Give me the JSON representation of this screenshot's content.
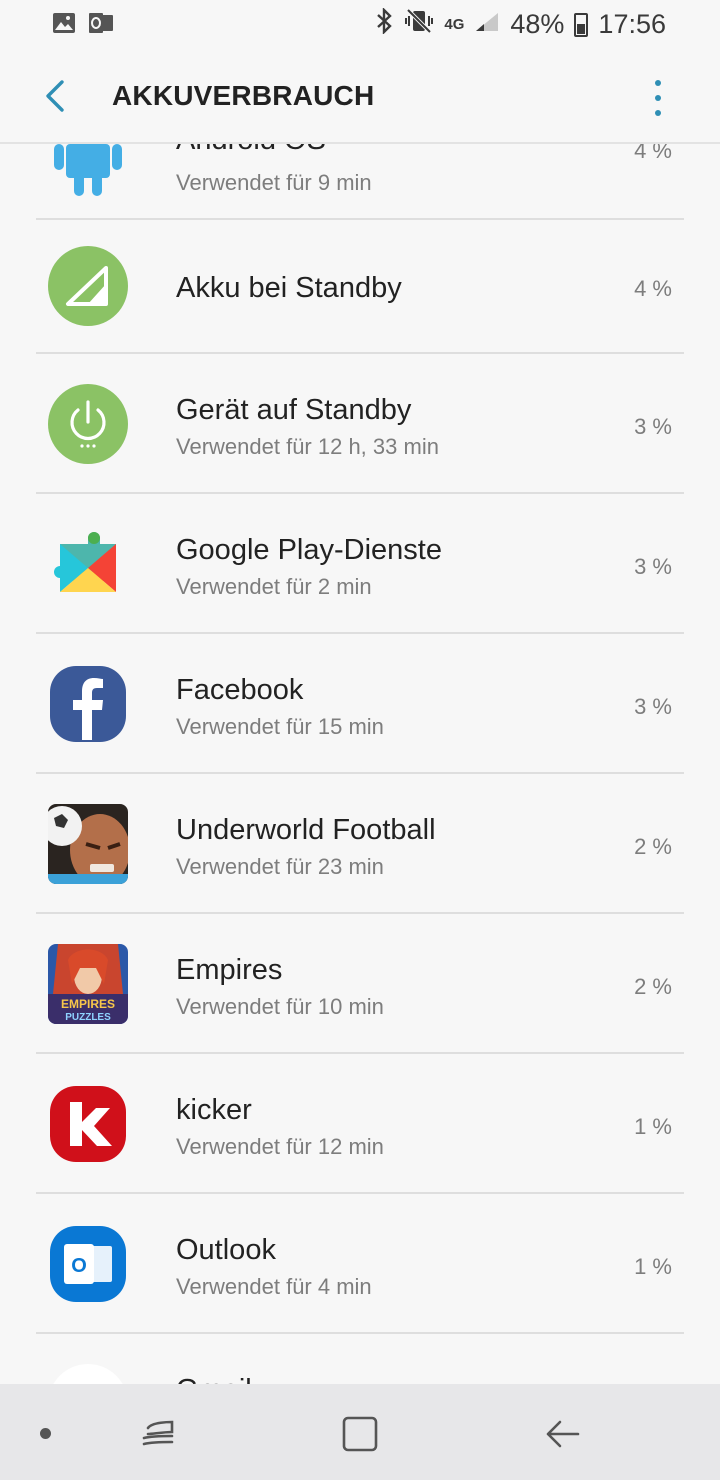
{
  "status_bar": {
    "left_icons": [
      "gallery-icon",
      "outlook-notification-icon"
    ],
    "right_icons": [
      "bluetooth-icon",
      "vibrate-mute-icon",
      "network-4g-icon",
      "signal-icon"
    ],
    "network": "4G",
    "battery_percent": "48%",
    "time": "17:56"
  },
  "app_bar": {
    "title": "AKKUVERBRAUCH",
    "back_icon": "back-arrow-icon",
    "menu_icon": "more-vertical-icon",
    "accent_color": "#2f8fb5"
  },
  "items": [
    {
      "name": "Android OS",
      "usage": "Verwendet für 9 min",
      "percent": "4 %",
      "icon": "android-icon"
    },
    {
      "name": "Akku bei Standby",
      "usage": "",
      "percent": "4 %",
      "icon": "cell-standby-icon"
    },
    {
      "name": "Gerät auf Standby",
      "usage": "Verwendet für 12 h, 33 min",
      "percent": "3 %",
      "icon": "device-standby-icon"
    },
    {
      "name": "Google Play-Dienste",
      "usage": "Verwendet für 2 min",
      "percent": "3 %",
      "icon": "google-play-services-icon"
    },
    {
      "name": "Facebook",
      "usage": "Verwendet für 15 min",
      "percent": "3 %",
      "icon": "facebook-icon"
    },
    {
      "name": "Underworld Football",
      "usage": "Verwendet für 23 min",
      "percent": "2 %",
      "icon": "underworld-football-icon"
    },
    {
      "name": "Empires",
      "usage": "Verwendet für 10 min",
      "percent": "2 %",
      "icon": "empires-puzzles-icon",
      "icon_text": [
        "EMPIRES",
        "PUZZLES"
      ]
    },
    {
      "name": "kicker",
      "usage": "Verwendet für 12 min",
      "percent": "1 %",
      "icon": "kicker-icon",
      "icon_text": "k"
    },
    {
      "name": "Outlook",
      "usage": "Verwendet für 4 min",
      "percent": "1 %",
      "icon": "outlook-icon",
      "icon_text": "O"
    },
    {
      "name": "Gmail",
      "usage": "",
      "percent": "",
      "icon": "gmail-icon"
    }
  ],
  "nav_bar": {
    "icons": [
      "nav-dot-icon",
      "recent-apps-icon",
      "home-icon",
      "back-icon"
    ]
  }
}
